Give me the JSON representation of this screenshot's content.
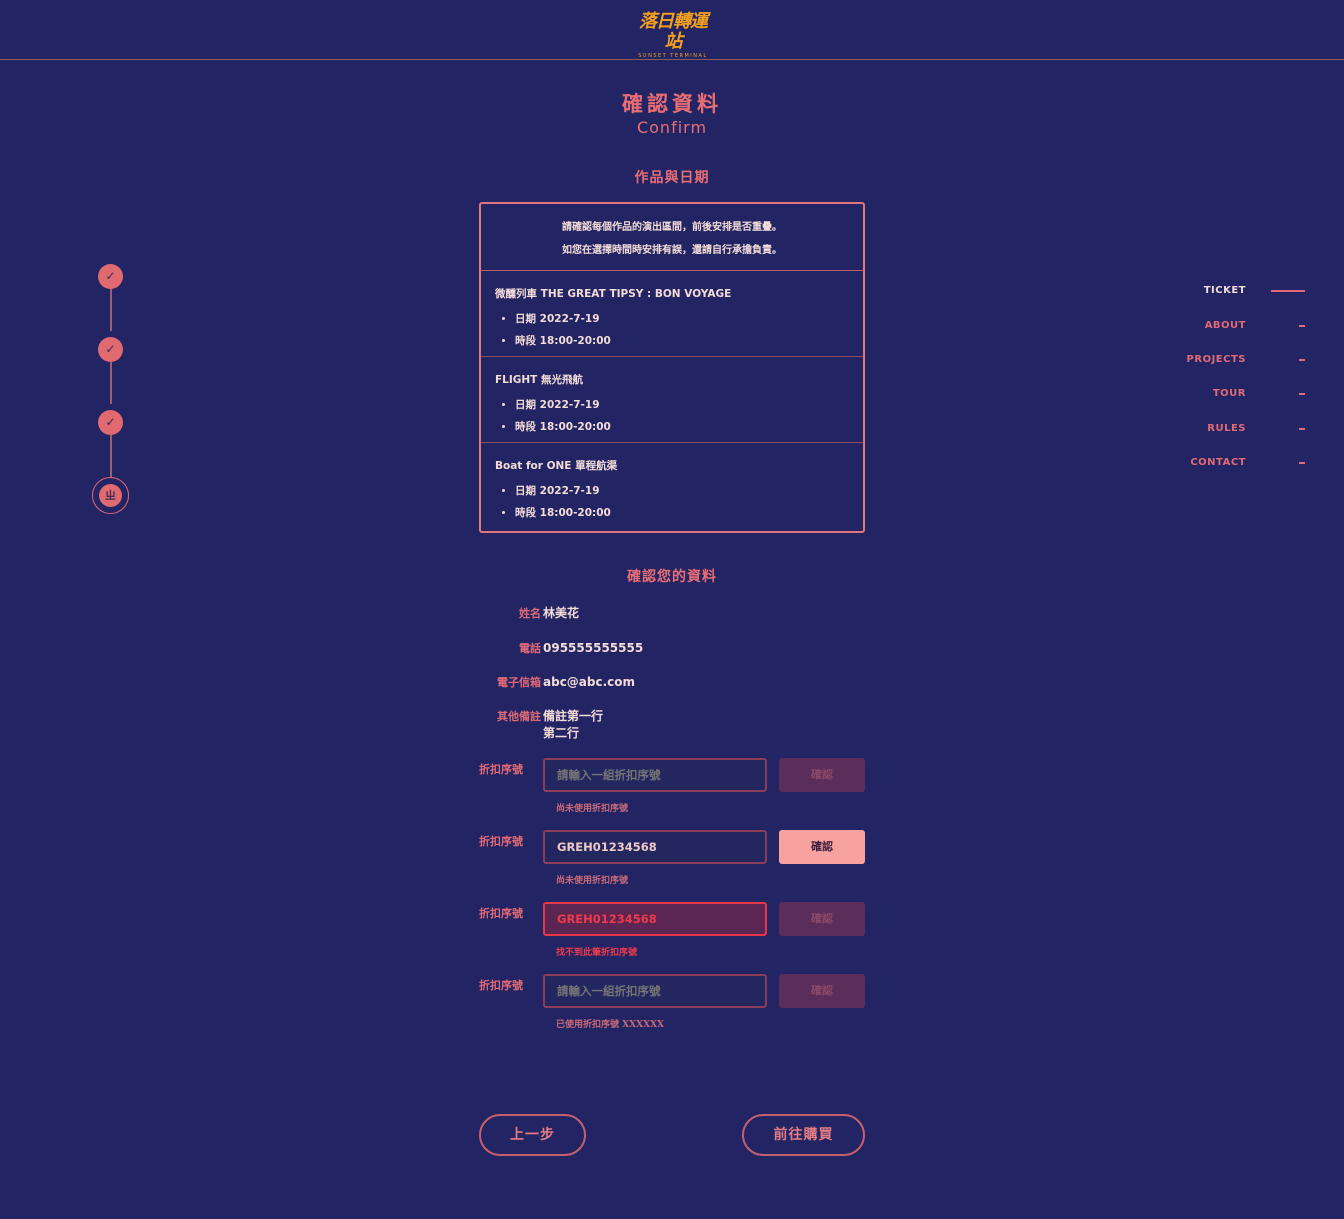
{
  "header": {
    "logo_main": "落日轉運站",
    "logo_sub": "SUNSET TERMINAL"
  },
  "page": {
    "title_zh": "確認資料",
    "title_en": "Confirm"
  },
  "works_section": {
    "title": "作品與日期",
    "notice_line1": "請確認每個作品的演出區間，前後安排是否重疊。",
    "notice_line2": "如您在選擇時間時安排有誤，還請自行承擔負責。",
    "items": [
      {
        "title": "微醺列車 THE GREAT TIPSY : BON VOYAGE",
        "date": "日期 2022-7-19",
        "time": "時段 18:00-20:00"
      },
      {
        "title": "FLIGHT 無光飛航",
        "date": "日期 2022-7-19",
        "time": "時段 18:00-20:00"
      },
      {
        "title": "Boat for ONE 單程航渠",
        "date": "日期 2022-7-19",
        "time": "時段 18:00-20:00"
      }
    ]
  },
  "info_section": {
    "title": "確認您的資料",
    "name_label": "姓名",
    "name_value": "林美花",
    "phone_label": "電話",
    "phone_value": "095555555555",
    "email_label": "電子信箱",
    "email_value": "abc@abc.com",
    "notes_label": "其他備註",
    "notes_line1": "備註第一行",
    "notes_line2": "第二行"
  },
  "discounts": [
    {
      "label": "折扣序號",
      "placeholder": "請輸入一組折扣序號",
      "value": "",
      "button": "確認",
      "message": "尚未使用折扣序號"
    },
    {
      "label": "折扣序號",
      "placeholder": "",
      "value": "GREH01234568",
      "button": "確認",
      "message": "尚未使用折扣序號"
    },
    {
      "label": "折扣序號",
      "placeholder": "",
      "value": "GREH01234568",
      "button": "確認",
      "message": "找不到此筆折扣序號"
    },
    {
      "label": "折扣序號",
      "placeholder": "請輸入一組折扣序號",
      "value": "",
      "button": "確認",
      "message": "已使用折扣序號 XXXXXX"
    }
  ],
  "actions": {
    "back": "上一步",
    "next": "前往購買"
  },
  "steps": {
    "done_icon": "check-icon",
    "current_icon": "ticket-icon",
    "current_glyph": "ㄓ"
  },
  "side_nav": {
    "items": [
      "TICKET",
      "ABOUT",
      "PROJECTS",
      "TOUR",
      "RULES",
      "CONTACT"
    ],
    "active": "TICKET"
  },
  "colors": {
    "background": "#222463",
    "accent": "#e86d74",
    "error": "#ee3a4c",
    "logo": "#f29f1e"
  }
}
